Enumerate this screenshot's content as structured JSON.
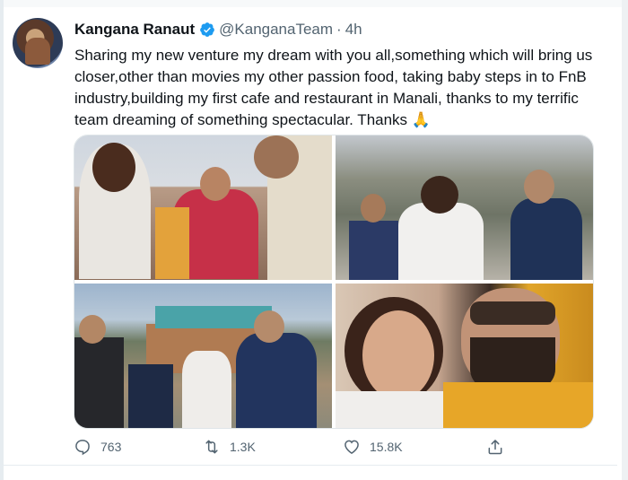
{
  "tweet": {
    "author_name": "Kangana Ranaut",
    "handle": "@KanganaTeam",
    "separator": "·",
    "time": "4h",
    "text": "Sharing my new venture my dream with you all,something which will bring us closer,other than movies my other passion food, taking baby steps in to FnB industry,building my first cafe and restaurant in Manali, thanks to my terrific team dreaming of something spectacular. Thanks 🙏"
  },
  "actions": {
    "reply_count": "763",
    "retweet_count": "1.3K",
    "like_count": "15.8K"
  },
  "icons": {
    "verified": "verified-badge-icon",
    "reply": "reply-icon",
    "retweet": "retweet-icon",
    "like": "like-icon",
    "share": "share-icon"
  },
  "colors": {
    "text": "#0f1419",
    "secondary": "#536471",
    "verified": "#1d9bf0"
  }
}
